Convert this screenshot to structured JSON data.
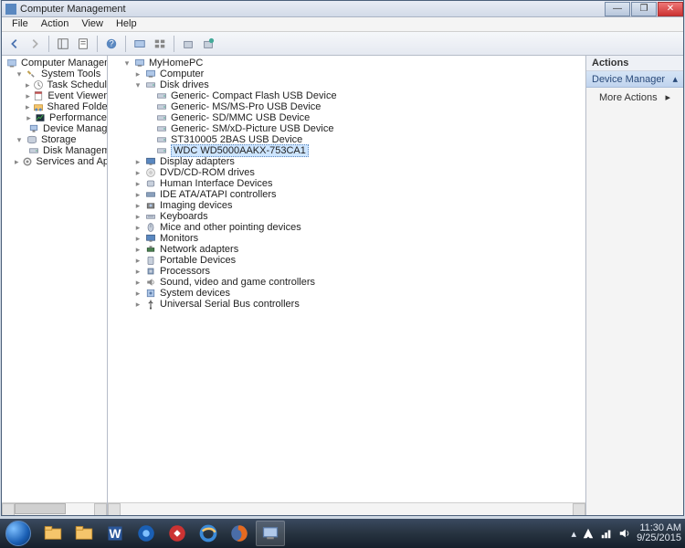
{
  "window": {
    "title": "Computer Management"
  },
  "menu": [
    "File",
    "Action",
    "View",
    "Help"
  ],
  "leftTree": [
    {
      "d": 0,
      "exp": "",
      "t": "Computer Management (Local)",
      "i": "console"
    },
    {
      "d": 1,
      "exp": "▾",
      "t": "System Tools",
      "i": "tools"
    },
    {
      "d": 2,
      "exp": "▸",
      "t": "Task Scheduler",
      "i": "clock"
    },
    {
      "d": 2,
      "exp": "▸",
      "t": "Event Viewer",
      "i": "event"
    },
    {
      "d": 2,
      "exp": "▸",
      "t": "Shared Folders",
      "i": "share"
    },
    {
      "d": 2,
      "exp": "▸",
      "t": "Performance",
      "i": "perf"
    },
    {
      "d": 2,
      "exp": "",
      "t": "Device Manager",
      "i": "dev"
    },
    {
      "d": 1,
      "exp": "▾",
      "t": "Storage",
      "i": "storage"
    },
    {
      "d": 2,
      "exp": "",
      "t": "Disk Management",
      "i": "disk"
    },
    {
      "d": 1,
      "exp": "▸",
      "t": "Services and Applications",
      "i": "svc"
    }
  ],
  "midTree": [
    {
      "d": 0,
      "exp": "▾",
      "t": "MyHomePC",
      "i": "pc"
    },
    {
      "d": 1,
      "exp": "▸",
      "t": "Computer",
      "i": "pc"
    },
    {
      "d": 1,
      "exp": "▾",
      "t": "Disk drives",
      "i": "drive"
    },
    {
      "d": 2,
      "exp": "",
      "t": "Generic- Compact Flash USB Device",
      "i": "drive"
    },
    {
      "d": 2,
      "exp": "",
      "t": "Generic- MS/MS-Pro USB Device",
      "i": "drive"
    },
    {
      "d": 2,
      "exp": "",
      "t": "Generic- SD/MMC USB Device",
      "i": "drive"
    },
    {
      "d": 2,
      "exp": "",
      "t": "Generic- SM/xD-Picture USB Device",
      "i": "drive"
    },
    {
      "d": 2,
      "exp": "",
      "t": "ST310005 2BAS USB Device",
      "i": "drive"
    },
    {
      "d": 2,
      "exp": "",
      "t": "WDC WD5000AAKX-753CA1",
      "i": "drive",
      "sel": true
    },
    {
      "d": 1,
      "exp": "▸",
      "t": "Display adapters",
      "i": "mon"
    },
    {
      "d": 1,
      "exp": "▸",
      "t": "DVD/CD-ROM drives",
      "i": "cd"
    },
    {
      "d": 1,
      "exp": "▸",
      "t": "Human Interface Devices",
      "i": "hid"
    },
    {
      "d": 1,
      "exp": "▸",
      "t": "IDE ATA/ATAPI controllers",
      "i": "ide"
    },
    {
      "d": 1,
      "exp": "▸",
      "t": "Imaging devices",
      "i": "cam"
    },
    {
      "d": 1,
      "exp": "▸",
      "t": "Keyboards",
      "i": "kb"
    },
    {
      "d": 1,
      "exp": "▸",
      "t": "Mice and other pointing devices",
      "i": "mouse"
    },
    {
      "d": 1,
      "exp": "▸",
      "t": "Monitors",
      "i": "mon"
    },
    {
      "d": 1,
      "exp": "▸",
      "t": "Network adapters",
      "i": "net"
    },
    {
      "d": 1,
      "exp": "▸",
      "t": "Portable Devices",
      "i": "port"
    },
    {
      "d": 1,
      "exp": "▸",
      "t": "Processors",
      "i": "cpu"
    },
    {
      "d": 1,
      "exp": "▸",
      "t": "Sound, video and game controllers",
      "i": "snd"
    },
    {
      "d": 1,
      "exp": "▸",
      "t": "System devices",
      "i": "sys"
    },
    {
      "d": 1,
      "exp": "▸",
      "t": "Universal Serial Bus controllers",
      "i": "usb"
    }
  ],
  "actions": {
    "header": "Actions",
    "section": "Device Manager",
    "moreActions": "More Actions"
  },
  "clock": {
    "time": "11:30 AM",
    "date": "9/25/2015"
  }
}
